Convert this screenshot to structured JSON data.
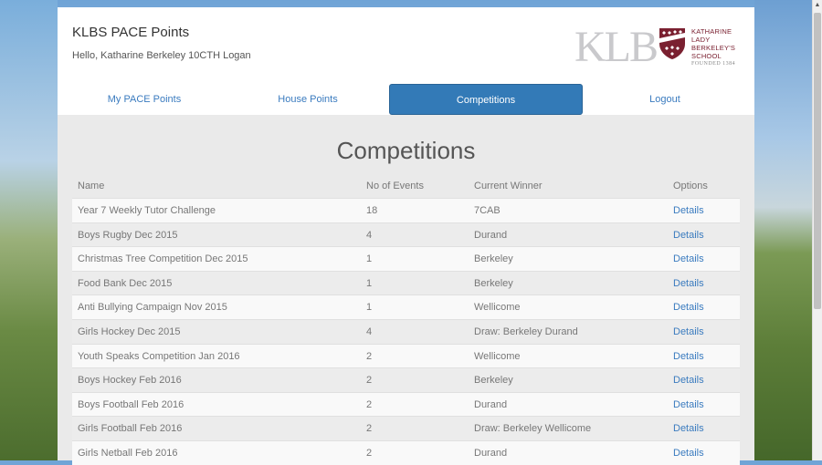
{
  "header": {
    "title": "KLBS PACE Points",
    "greeting": "Hello, Katharine Berkeley  10CTH  Logan"
  },
  "logo": {
    "initials": "KLB",
    "text_lines": [
      "KATHARINE",
      "LADY",
      "BERKELEY'S",
      "SCHOOL"
    ],
    "founded": "FOUNDED 1384",
    "color": "#7a2030"
  },
  "nav": {
    "items": [
      {
        "label": "My PACE Points",
        "active": false
      },
      {
        "label": "House Points",
        "active": false
      },
      {
        "label": "Competitions",
        "active": true
      },
      {
        "label": "Logout",
        "active": false
      }
    ],
    "accent": "#337ab7"
  },
  "page": {
    "title": "Competitions"
  },
  "table": {
    "headers": [
      "Name",
      "No of Events",
      "Current Winner",
      "Options"
    ],
    "rows": [
      {
        "name": "Year 7 Weekly Tutor Challenge",
        "events": "18",
        "winner": "7CAB",
        "option": "Details"
      },
      {
        "name": "Boys Rugby Dec 2015",
        "events": "4",
        "winner": "Durand",
        "option": "Details"
      },
      {
        "name": "Christmas Tree Competition Dec 2015",
        "events": "1",
        "winner": "Berkeley",
        "option": "Details"
      },
      {
        "name": "Food Bank Dec 2015",
        "events": "1",
        "winner": "Berkeley",
        "option": "Details"
      },
      {
        "name": "Anti Bullying Campaign Nov 2015",
        "events": "1",
        "winner": "Wellicome",
        "option": "Details"
      },
      {
        "name": "Girls Hockey Dec 2015",
        "events": "4",
        "winner": "Draw: Berkeley Durand",
        "option": "Details"
      },
      {
        "name": "Youth Speaks Competition Jan 2016",
        "events": "2",
        "winner": "Wellicome",
        "option": "Details"
      },
      {
        "name": "Boys Hockey Feb 2016",
        "events": "2",
        "winner": "Berkeley",
        "option": "Details"
      },
      {
        "name": "Boys Football Feb 2016",
        "events": "2",
        "winner": "Durand",
        "option": "Details"
      },
      {
        "name": "Girls Football Feb 2016",
        "events": "2",
        "winner": "Draw: Berkeley Wellicome",
        "option": "Details"
      },
      {
        "name": "Girls Netball Feb 2016",
        "events": "2",
        "winner": "Durand",
        "option": "Details"
      }
    ]
  }
}
